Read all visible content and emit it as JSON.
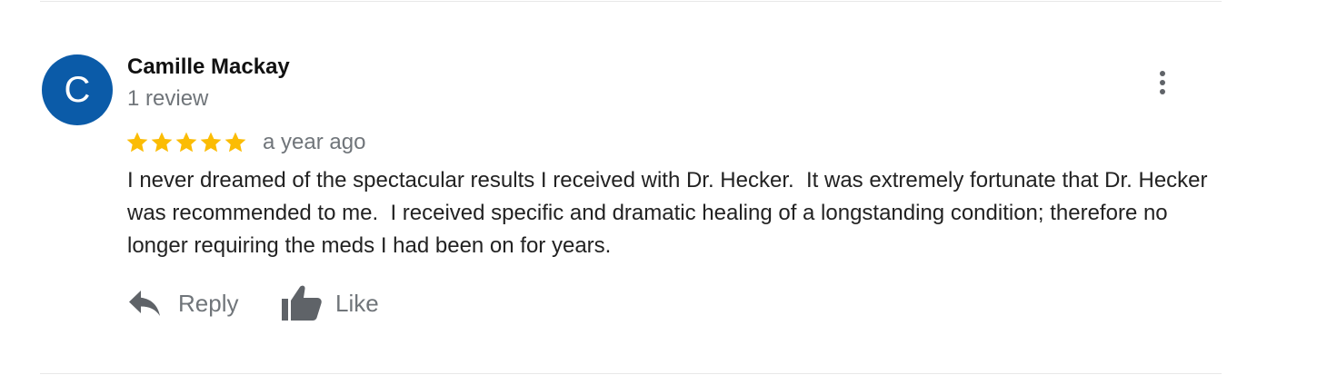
{
  "review": {
    "avatar": {
      "initial": "C",
      "color": "#0b5ba8"
    },
    "reviewer_name": "Camille Mackay",
    "review_count": "1 review",
    "rating": {
      "stars": 5,
      "max": 5,
      "color": "#fbbc04"
    },
    "date": "a year ago",
    "text": "I never dreamed of the spectacular results I received with Dr. Hecker.  It was extremely fortunate that Dr. Hecker was recommended to me.  I received specific and dramatic healing of a longstanding condition; therefore no longer requiring the meds I had been on for years.",
    "more_icon": "more-vertical-icon"
  },
  "actions": {
    "reply_label": "Reply",
    "reply_icon": "reply-arrow-icon",
    "like_label": "Like",
    "like_icon": "thumbs-up-icon"
  }
}
